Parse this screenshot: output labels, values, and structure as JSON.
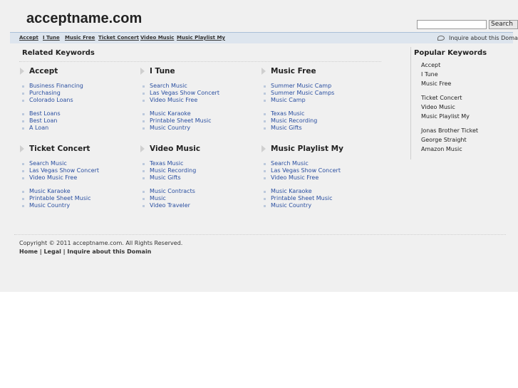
{
  "header": {
    "site_title": "acceptname.com",
    "search": {
      "value": "",
      "placeholder": "",
      "button_label": "Search"
    }
  },
  "nav": {
    "links": [
      "Accept",
      "I Tune",
      "Music Free",
      "Ticket Concert",
      "Video Music",
      "Music Playlist My"
    ],
    "inquire_label": "Inquire about this Domain",
    "inquire_icon": "speech-bubble-icon"
  },
  "related": {
    "heading": "Related Keywords",
    "blocks": [
      {
        "title": "Accept",
        "groups": [
          [
            "Business Financing",
            "Purchasing",
            "Colorado Loans"
          ],
          [
            "Best Loans",
            "Best Loan",
            "A Loan"
          ]
        ]
      },
      {
        "title": "I Tune",
        "groups": [
          [
            "Search Music",
            "Las Vegas Show Concert",
            "Video Music Free"
          ],
          [
            "Music Karaoke",
            "Printable Sheet Music",
            "Music Country"
          ]
        ]
      },
      {
        "title": "Music Free",
        "groups": [
          [
            "Summer Music Camp",
            "Summer Music Camps",
            "Music Camp"
          ],
          [
            "Texas Music",
            "Music Recording",
            "Music Gifts"
          ]
        ]
      },
      {
        "title": "Ticket Concert",
        "groups": [
          [
            "Search Music",
            "Las Vegas Show Concert",
            "Video Music Free"
          ],
          [
            "Music Karaoke",
            "Printable Sheet Music",
            "Music Country"
          ]
        ]
      },
      {
        "title": "Video Music",
        "groups": [
          [
            "Texas Music",
            "Music Recording",
            "Music Gifts"
          ],
          [
            "Music Contracts",
            "Music",
            "Video Traveler"
          ]
        ]
      },
      {
        "title": "Music Playlist My",
        "groups": [
          [
            "Search Music",
            "Las Vegas Show Concert",
            "Video Music Free"
          ],
          [
            "Music Karaoke",
            "Printable Sheet Music",
            "Music Country"
          ]
        ]
      }
    ]
  },
  "popular": {
    "heading": "Popular Keywords",
    "groups": [
      [
        "Accept",
        "I Tune",
        "Music Free"
      ],
      [
        "Ticket Concert",
        "Video Music",
        "Music Playlist My"
      ],
      [
        "Jonas Brother Ticket",
        "George Straight",
        "Amazon Music"
      ]
    ]
  },
  "footer": {
    "copyright": "Copyright © 2011 acceptname.com. All Rights Reserved.",
    "links": [
      "Home",
      "Legal",
      "Inquire about this Domain"
    ],
    "separator": " | "
  },
  "colors": {
    "background": "#f0f0f0",
    "nav_bar": "#dde5ee",
    "link": "#2a4fa0"
  }
}
